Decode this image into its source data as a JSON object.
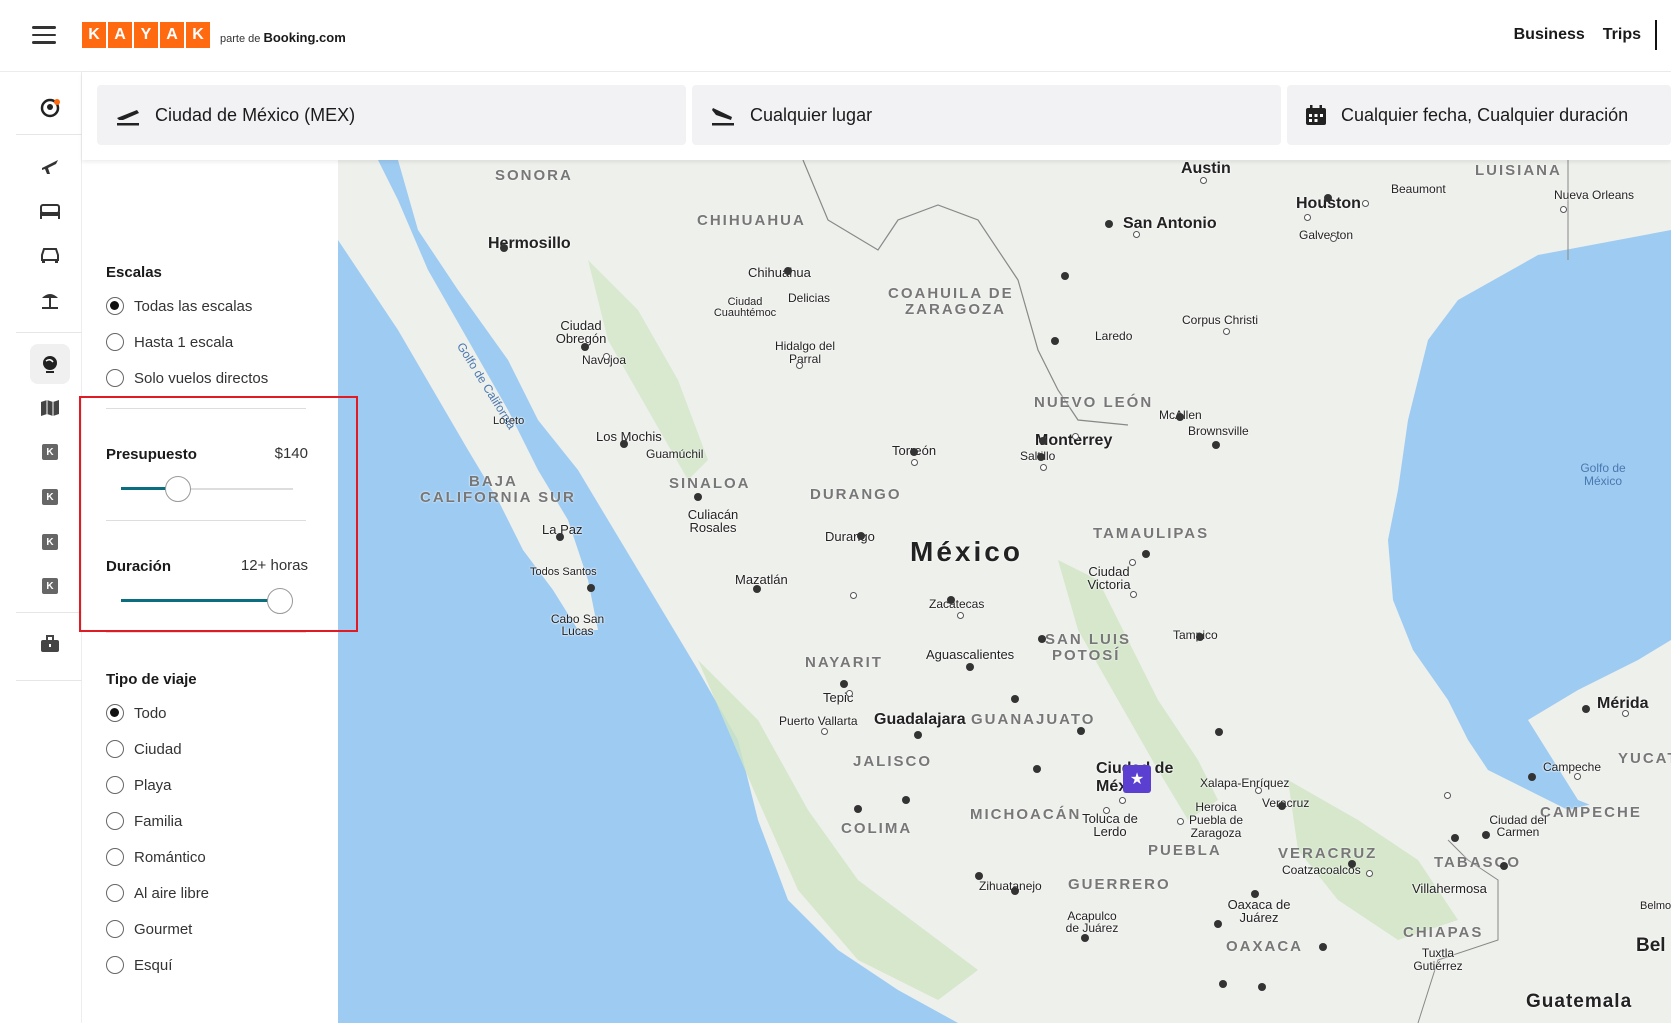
{
  "header": {
    "logo_letters": [
      "K",
      "A",
      "Y",
      "A",
      "K"
    ],
    "logo_prefix": "parte de",
    "logo_partner": "Booking.com",
    "links": [
      "Business",
      "Trips"
    ]
  },
  "search": {
    "origin": "Ciudad de México (MEX)",
    "destination": "Cualquier lugar",
    "dates": "Cualquier fecha, Cualquier duración"
  },
  "rail_icons": [
    "profile-icon",
    "plane-icon",
    "bed-icon",
    "car-icon",
    "beach-icon",
    "explore-icon",
    "map-icon",
    "kayak-k-icon",
    "kayak-k-icon",
    "kayak-k-icon",
    "kayak-k-icon",
    "briefcase-icon"
  ],
  "filters": {
    "stops": {
      "title": "Escalas",
      "options": [
        {
          "label": "Todas las escalas",
          "checked": true
        },
        {
          "label": "Hasta 1 escala",
          "checked": false
        },
        {
          "label": "Solo vuelos directos",
          "checked": false
        }
      ]
    },
    "budget": {
      "title": "Presupuesto",
      "value": "$140",
      "level": 0.3
    },
    "duration": {
      "title": "Duración",
      "value": "12+ horas",
      "level": 1.0
    },
    "trip_type": {
      "title": "Tipo de viaje",
      "options": [
        {
          "label": "Todo",
          "checked": true
        },
        {
          "label": "Ciudad",
          "checked": false
        },
        {
          "label": "Playa",
          "checked": false
        },
        {
          "label": "Familia",
          "checked": false
        },
        {
          "label": "Romántico",
          "checked": false
        },
        {
          "label": "Al aire libre",
          "checked": false
        },
        {
          "label": "Gourmet",
          "checked": false
        },
        {
          "label": "Esquí",
          "checked": false
        }
      ]
    }
  },
  "map": {
    "country": "México",
    "states": [
      "SONORA",
      "CHIHUAHUA",
      "COAHUILA DE",
      "ZARAGOZA",
      "NUEVO LEÓN",
      "BAJA",
      "CALIFORNIA SUR",
      "SINALOA",
      "DURANGO",
      "TAMAULIPAS",
      "NAYARIT",
      "SAN LUIS",
      "POTOSÍ",
      "JALISCO",
      "GUANAJUATO",
      "COLIMA",
      "MICHOACÁN",
      "PUEBLA",
      "GUERRERO",
      "VERACRUZ",
      "OAXACA",
      "TABASCO",
      "CHIAPAS",
      "CAMPECHE",
      "YUCATA",
      "LUISIANA"
    ],
    "cities_big": [
      "Austin",
      "Houston",
      "San Antonio",
      "Monterrey",
      "Guadalajara",
      "Mérida",
      "Guatemala",
      "Hermosillo",
      "Ciudad de México",
      "Bel"
    ],
    "cities": [
      "Beaumont",
      "Nueva Orleans",
      "Galveston",
      "Corpus Christi",
      "Laredo",
      "McAllen",
      "Brownsville",
      "Chihuahua",
      "Delicias",
      "Ciudad Cuauhtémoc",
      "Hidalgo del Parral",
      "Ciudad Obregón",
      "Navojoa",
      "Los Mochis",
      "Guamúchil",
      "Loreto",
      "Culiacán Rosales",
      "La Paz",
      "Todos Santos",
      "Cabo San Lucas",
      "Torreón",
      "Saltillo",
      "Durango",
      "Mazatlán",
      "Zacatecas",
      "Ciudad Victoria",
      "Tampico",
      "Aguascalientes",
      "Tepic",
      "Puerto Vallarta",
      "Xalapa-Enríquez",
      "Veracruz",
      "Heroica Puebla de Zaragoza",
      "Toluca de Lerdo",
      "Coatzacoalcos",
      "Villahermosa",
      "Ciudad del Carmen",
      "Campeche",
      "Zihuatanejo",
      "Acapulco de Juárez",
      "Oaxaca de Juárez",
      "Tuxtla Gutiérrez",
      "Belmo"
    ],
    "seas": [
      "Golfo de California",
      "Golfo de México"
    ],
    "land_color": "#eef0ec",
    "water_color": "#9ecbf2",
    "green_color": "#cfe5c4",
    "pin_color": "#5a3fd1"
  },
  "colors": {
    "brand": "#ff690f",
    "slider": "#0b6e7f",
    "highlight": "#e01b24"
  }
}
